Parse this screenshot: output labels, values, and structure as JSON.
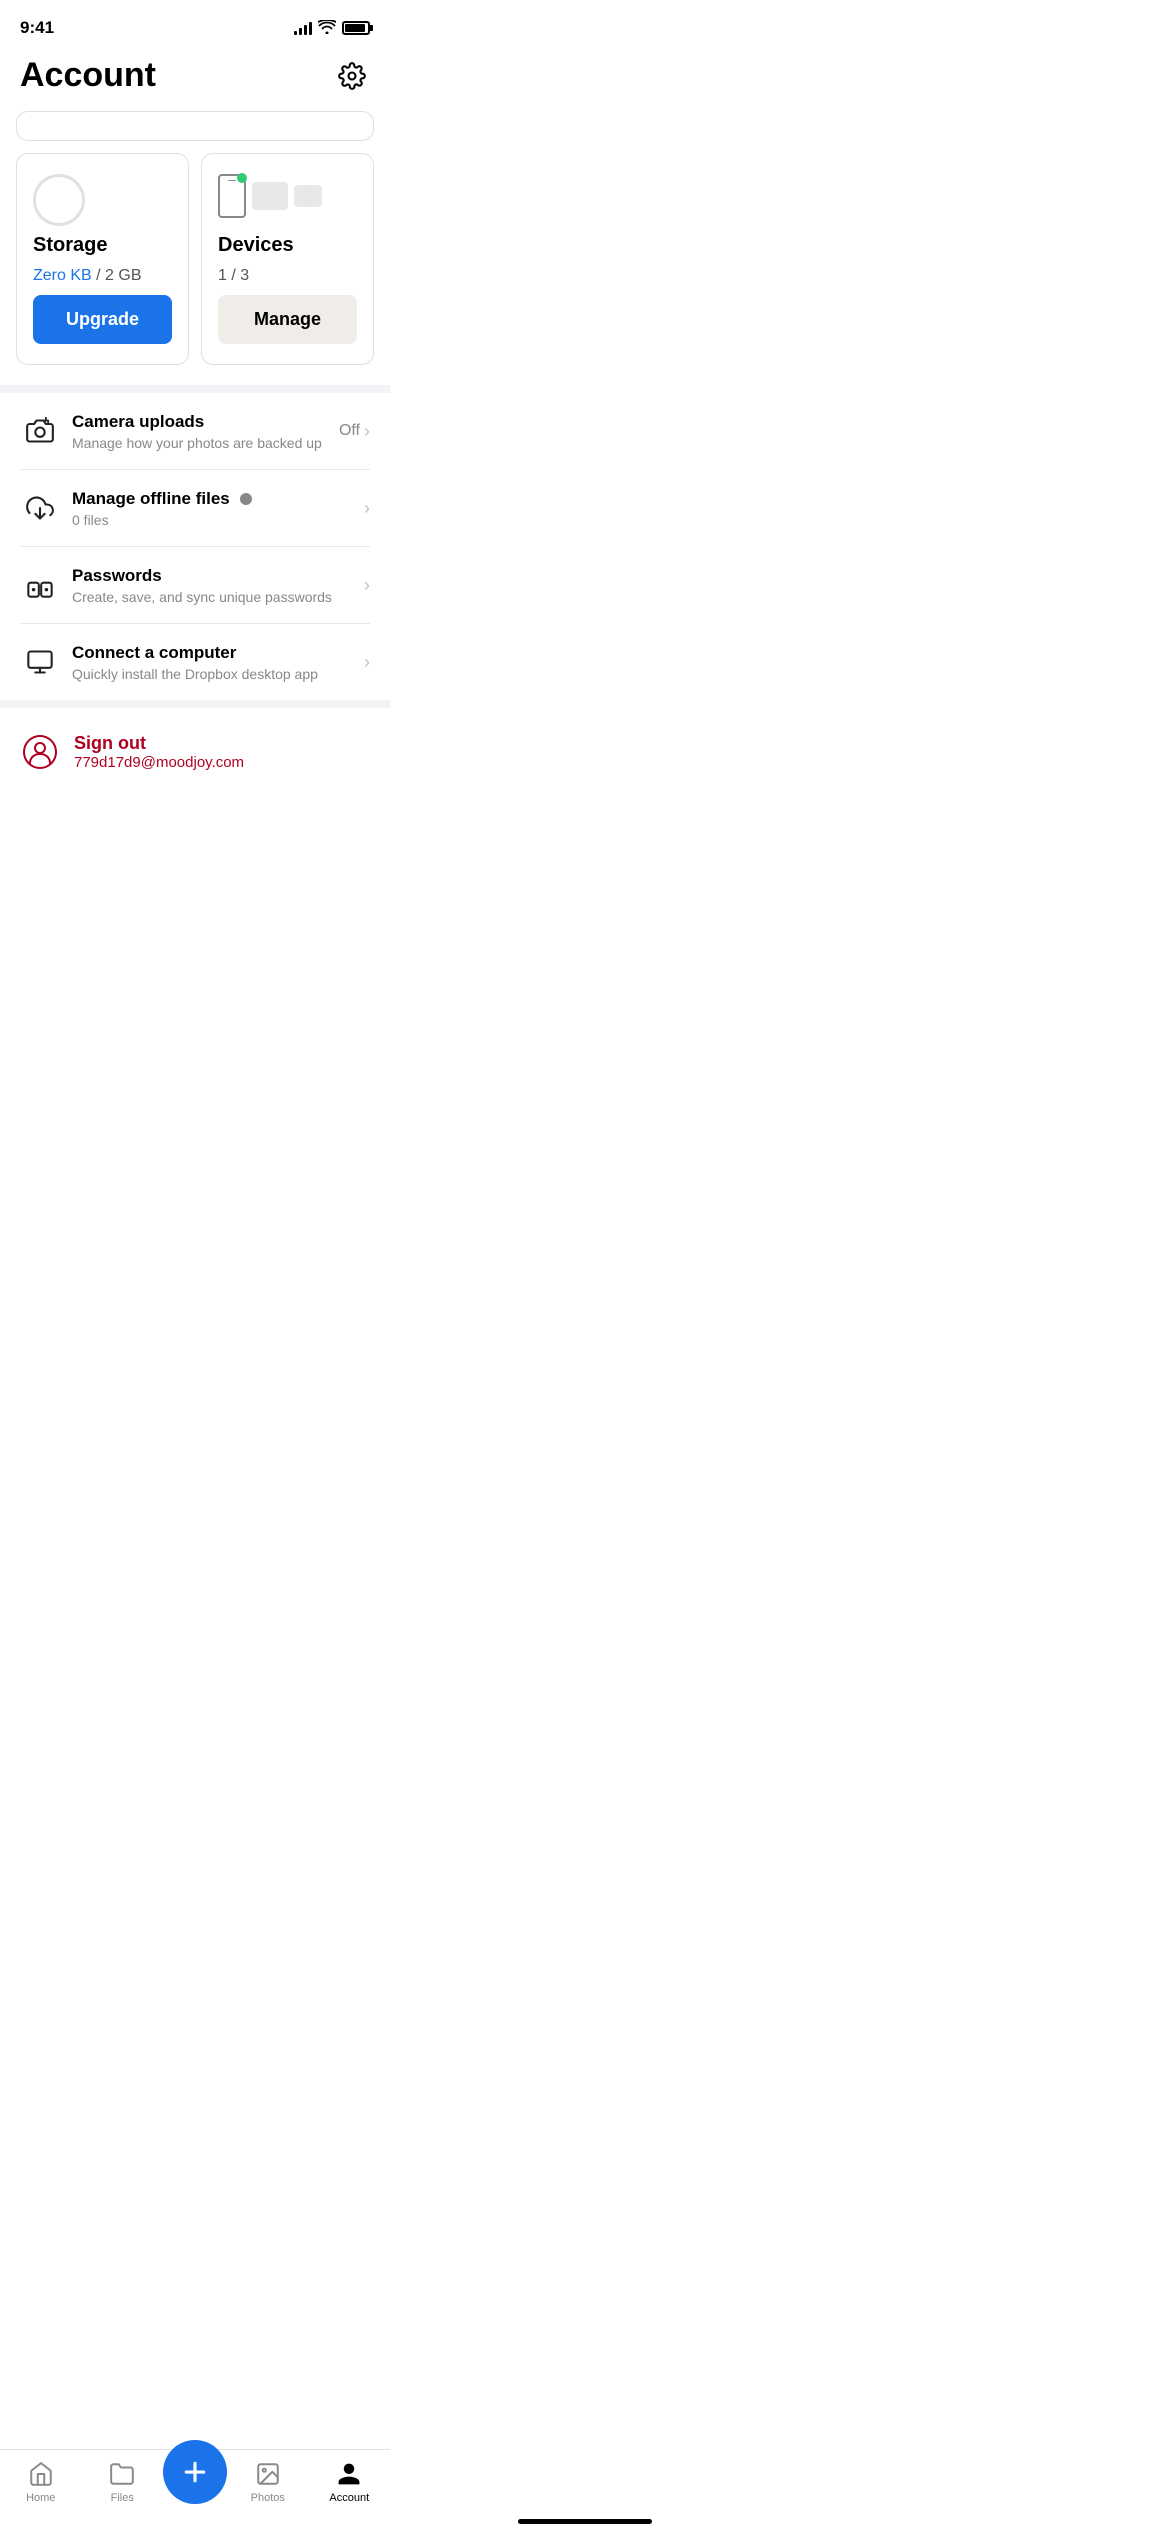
{
  "statusBar": {
    "time": "9:41",
    "signalBars": [
      4,
      6,
      9,
      11,
      14
    ],
    "batteryLevel": 90
  },
  "header": {
    "title": "Account",
    "settingsIconLabel": "Settings"
  },
  "storageCard": {
    "title": "Storage",
    "usedLabel": "Zero KB",
    "totalLabel": "2 GB",
    "separator": "/",
    "upgradeButton": "Upgrade"
  },
  "devicesCard": {
    "title": "Devices",
    "countLabel": "1 / 3",
    "manageButton": "Manage"
  },
  "menuItems": [
    {
      "id": "camera-uploads",
      "label": "Camera uploads",
      "sublabel": "Manage how your photos are backed up",
      "status": "Off",
      "hasChevron": true
    },
    {
      "id": "offline-files",
      "label": "Manage offline files",
      "sublabel": "0 files",
      "status": "",
      "hasChevron": true,
      "hasBadge": true
    },
    {
      "id": "passwords",
      "label": "Passwords",
      "sublabel": "Create, save, and sync unique passwords",
      "status": "",
      "hasChevron": true
    },
    {
      "id": "connect-computer",
      "label": "Connect a computer",
      "sublabel": "Quickly install the Dropbox desktop app",
      "status": "",
      "hasChevron": true
    }
  ],
  "signOut": {
    "label": "Sign out",
    "email": "779d17d9@moodjoy.com"
  },
  "tabBar": {
    "items": [
      {
        "id": "home",
        "label": "Home",
        "active": false
      },
      {
        "id": "files",
        "label": "Files",
        "active": false
      },
      {
        "id": "add",
        "label": "",
        "isFab": true
      },
      {
        "id": "photos",
        "label": "Photos",
        "active": false
      },
      {
        "id": "account",
        "label": "Account",
        "active": true
      }
    ]
  }
}
